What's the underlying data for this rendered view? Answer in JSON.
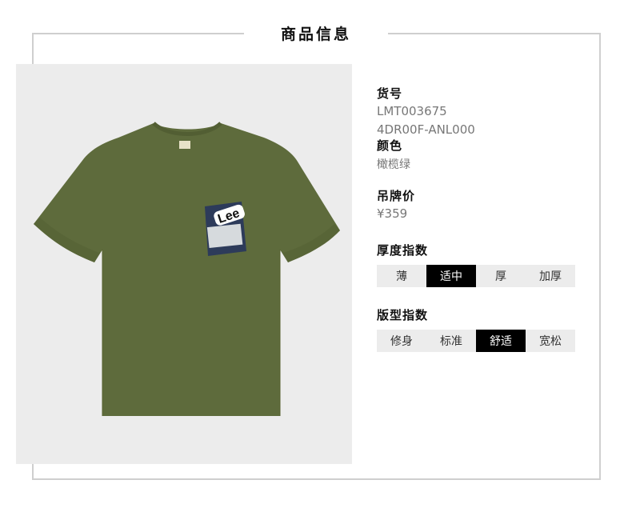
{
  "header": {
    "title": "商品信息"
  },
  "product": {
    "code_label": "货号",
    "code_1": "LMT003675",
    "code_2": "4DR00F-ANL000",
    "color_label": "颜色",
    "color_value": "橄榄绿",
    "price_label": "吊牌价",
    "price_value": "¥359",
    "garment_color": "#5e6b3c"
  },
  "thickness": {
    "label": "厚度指数",
    "options": [
      "薄",
      "适中",
      "厚",
      "加厚"
    ],
    "selected": "适中"
  },
  "fit": {
    "label": "版型指数",
    "options": [
      "修身",
      "标准",
      "舒适",
      "宽松"
    ],
    "selected": "舒适"
  },
  "colors": {
    "selected_bg": "#000000",
    "unselected_bg": "#ececec",
    "frame": "#cfcfcf"
  }
}
